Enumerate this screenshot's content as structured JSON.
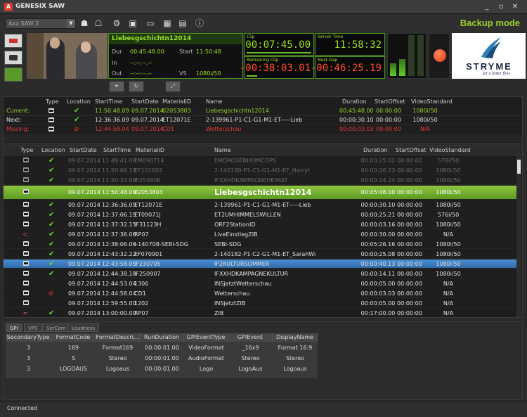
{
  "window": {
    "title": "GENESIX SAW"
  },
  "toolbar": {
    "channel_select": "Axx SAW 2",
    "mode": "Backup mode"
  },
  "info": {
    "title": "Liebesgschichtn12014",
    "dur_label": "Dur",
    "dur": "00:45:48.00",
    "start_label": "Start",
    "start": "11:50:48",
    "in_label": "In",
    "in": "--:--:--.--",
    "out_label": "Out",
    "out": "--:--:--.--",
    "vs_label": "VS",
    "vs": "1080i/50"
  },
  "clocks": {
    "clip_label": "Clip",
    "clip": "00:07:45.00",
    "server_label": "Server Time",
    "server": "11:58:32",
    "remaining_label": "Remaining Clip",
    "remaining": "-00:38:03.01",
    "gap_label": "Next Gap",
    "gap": "-00:46:25.19"
  },
  "brand": {
    "name": "STRYME",
    "tagline": "for a better flow"
  },
  "top_table": {
    "headers": [
      "Type",
      "Location",
      "StartTime",
      "StartDate",
      "MaterialID",
      "Name",
      "Duration",
      "StartOffset",
      "VideoStandard"
    ],
    "rows": [
      {
        "label": "Current:",
        "starttime": "11:50:48.09",
        "startdate": "09.07.2014",
        "materialid": "02053803",
        "name": "Liebesgschichtn12014",
        "duration": "00:45:48.00",
        "offset": "00:00:00",
        "vs": "1080i/50",
        "loc": "check",
        "color": "#9bd22d"
      },
      {
        "label": "Next:",
        "starttime": "12:36:36.09",
        "startdate": "09.07.2014",
        "materialid": "ET12071E",
        "name": "2-139961-P1-C1-G1-M1-ET-----Lieb",
        "duration": "00:00:30.10",
        "offset": "00:00:00",
        "vs": "1080i/50",
        "loc": "check",
        "color": "#e0e0e0"
      },
      {
        "label": "Missing:",
        "starttime": "12:44:58.04",
        "startdate": "09.07.2014",
        "materialid": "CD1",
        "name": "Wetterschau",
        "duration": "00:00:03.03",
        "offset": "00:00:00",
        "vs": "N/A",
        "loc": "no",
        "color": "#e33b3b"
      }
    ]
  },
  "playlist": {
    "headers": [
      "Type",
      "Location",
      "StartDate",
      "StartTime",
      "MaterialID",
      "Name",
      "Duration",
      "StartOffset",
      "VideoStandard"
    ],
    "rows": [
      {
        "type": "tape",
        "loc": "check",
        "date": "09.07.2014",
        "time": "11:49:41.09",
        "mid": "EM090714",
        "name": "EMDROSENHEIMCOPS",
        "dur": "00:00:25.02",
        "off": "00:00:00",
        "vs": "576i/50",
        "state": "past"
      },
      {
        "type": "tape",
        "loc": "check",
        "date": "09.07.2014",
        "time": "11:50:06.11",
        "mid": "EF102802",
        "name": "2-140180-P1-C1-G1-M1-EF_Harryt",
        "dur": "00:00:26.23",
        "off": "00:00:00",
        "vs": "1080i/50",
        "state": "past"
      },
      {
        "type": "tape",
        "loc": "check",
        "date": "09.07.2014",
        "time": "11:50:33.09",
        "mid": "IF250906",
        "name": "IFXXHDKAMPAGNEHEIMAT",
        "dur": "00:00:14.24",
        "off": "00:00:00",
        "vs": "1080i/50",
        "state": "past"
      },
      {
        "type": "tape",
        "loc": "check",
        "date": "09.07.2014",
        "time": "11:50:48.09",
        "mid": "02053803",
        "name": "Liebesgschichtn12014",
        "dur": "00:45:48.00",
        "off": "00:00:00",
        "vs": "1080i/50",
        "state": "current"
      },
      {
        "type": "tape",
        "loc": "check",
        "date": "09.07.2014",
        "time": "12:36:36.09",
        "mid": "ET12071E",
        "name": "2-139961-P1-C1-G1-M1-ET-----Lieb",
        "dur": "00:00:30.10",
        "off": "00:00:00",
        "vs": "1080i/50",
        "state": "normal"
      },
      {
        "type": "tape",
        "loc": "check",
        "date": "09.07.2014",
        "time": "12:37:06.19",
        "mid": "ET09071J",
        "name": "ET2UMHIMMELSWILLEN",
        "dur": "00:00:25.21",
        "off": "00:00:00",
        "vs": "576i/50",
        "state": "normal"
      },
      {
        "type": "tape",
        "loc": "check",
        "date": "09.07.2014",
        "time": "12:37:32.15",
        "mid": "IF31123H",
        "name": "ORF2StationID",
        "dur": "00:00:03.16",
        "off": "00:00:00",
        "vs": "1080i/50",
        "state": "normal"
      },
      {
        "type": "live",
        "loc": "check",
        "date": "09.07.2014",
        "time": "12:37:36.06",
        "mid": "RP07",
        "name": "LiveEinstiegZIB",
        "dur": "00:00:30.00",
        "off": "00:00:00",
        "vs": "N/A",
        "state": "normal"
      },
      {
        "type": "tape",
        "loc": "check",
        "date": "09.07.2014",
        "time": "12:38:06.06",
        "mid": "I-140708-SEBI-SDG",
        "name": "SEBI-SDG",
        "dur": "00:05:26.16",
        "off": "00:00:00",
        "vs": "1080i/50",
        "state": "normal"
      },
      {
        "type": "tape",
        "loc": "check",
        "date": "09.07.2014",
        "time": "12:43:32.22",
        "mid": "EF070901",
        "name": "2-140182-P1-C2-G1-M1-ET_SarahWi",
        "dur": "00:00:25.08",
        "off": "00:00:00",
        "vs": "1080i/50",
        "state": "normal"
      },
      {
        "type": "tape",
        "loc": "check",
        "date": "09.07.2014",
        "time": "12:43:58.05",
        "mid": "IF230705",
        "name": "IF2KULTURSOMMER",
        "dur": "00:00:40.13",
        "off": "00:00:00",
        "vs": "1080i/50",
        "state": "selected"
      },
      {
        "type": "tape",
        "loc": "check",
        "date": "09.07.2014",
        "time": "12:44:38.18",
        "mid": "IF250907",
        "name": "IFXXHDKAMPAGNEKULTUR",
        "dur": "00:00:14.11",
        "off": "00:00:00",
        "vs": "1080i/50",
        "state": "normal"
      },
      {
        "type": "tape",
        "loc": "none",
        "date": "09.07.2014",
        "time": "12:44:53.04",
        "mid": "1306",
        "name": "INSjetztWetterschau",
        "dur": "00:00:05.00",
        "off": "00:00:00",
        "vs": "N/A",
        "state": "normal"
      },
      {
        "type": "tape",
        "loc": "no",
        "date": "09.07.2014",
        "time": "12:44:58.04",
        "mid": "CD1",
        "name": "Wetterschau",
        "dur": "00:00:03.03",
        "off": "00:00:00",
        "vs": "N/A",
        "state": "normal"
      },
      {
        "type": "tape",
        "loc": "none",
        "date": "09.07.2014",
        "time": "12:59:55.00",
        "mid": "1202",
        "name": "INSjetztZIB",
        "dur": "00:00:05.00",
        "off": "00:00:00",
        "vs": "N/A",
        "state": "normal"
      },
      {
        "type": "live",
        "loc": "check",
        "date": "09.07.2014",
        "time": "13:00:00.00",
        "mid": "RP07",
        "name": "ZIB",
        "dur": "00:17:00.00",
        "off": "00:00:00",
        "vs": "N/A",
        "state": "normal"
      }
    ]
  },
  "bottom": {
    "tabs": [
      "GPI",
      "VPS",
      "SerCom",
      "Loudness"
    ],
    "headers": [
      "SecondaryType",
      "FormatCode",
      "FormatDescri...",
      "RunDuration",
      "GPIEventType",
      "GPIEvent",
      "DisplayName"
    ],
    "rows": [
      [
        "3",
        "169",
        "Format169",
        "00:00:01.00",
        "VideoFormat",
        "_16x9",
        "Format 16:9"
      ],
      [
        "3",
        "S",
        "Stereo",
        "00:00:01.00",
        "AudioFormat",
        "Stereo",
        "Stereo"
      ],
      [
        "3",
        "LOGOAUS",
        "Logoaus",
        "00:00:01.00",
        "Logo",
        "LogoAus",
        "Logoaus"
      ]
    ]
  },
  "status": {
    "text": "Connected"
  }
}
